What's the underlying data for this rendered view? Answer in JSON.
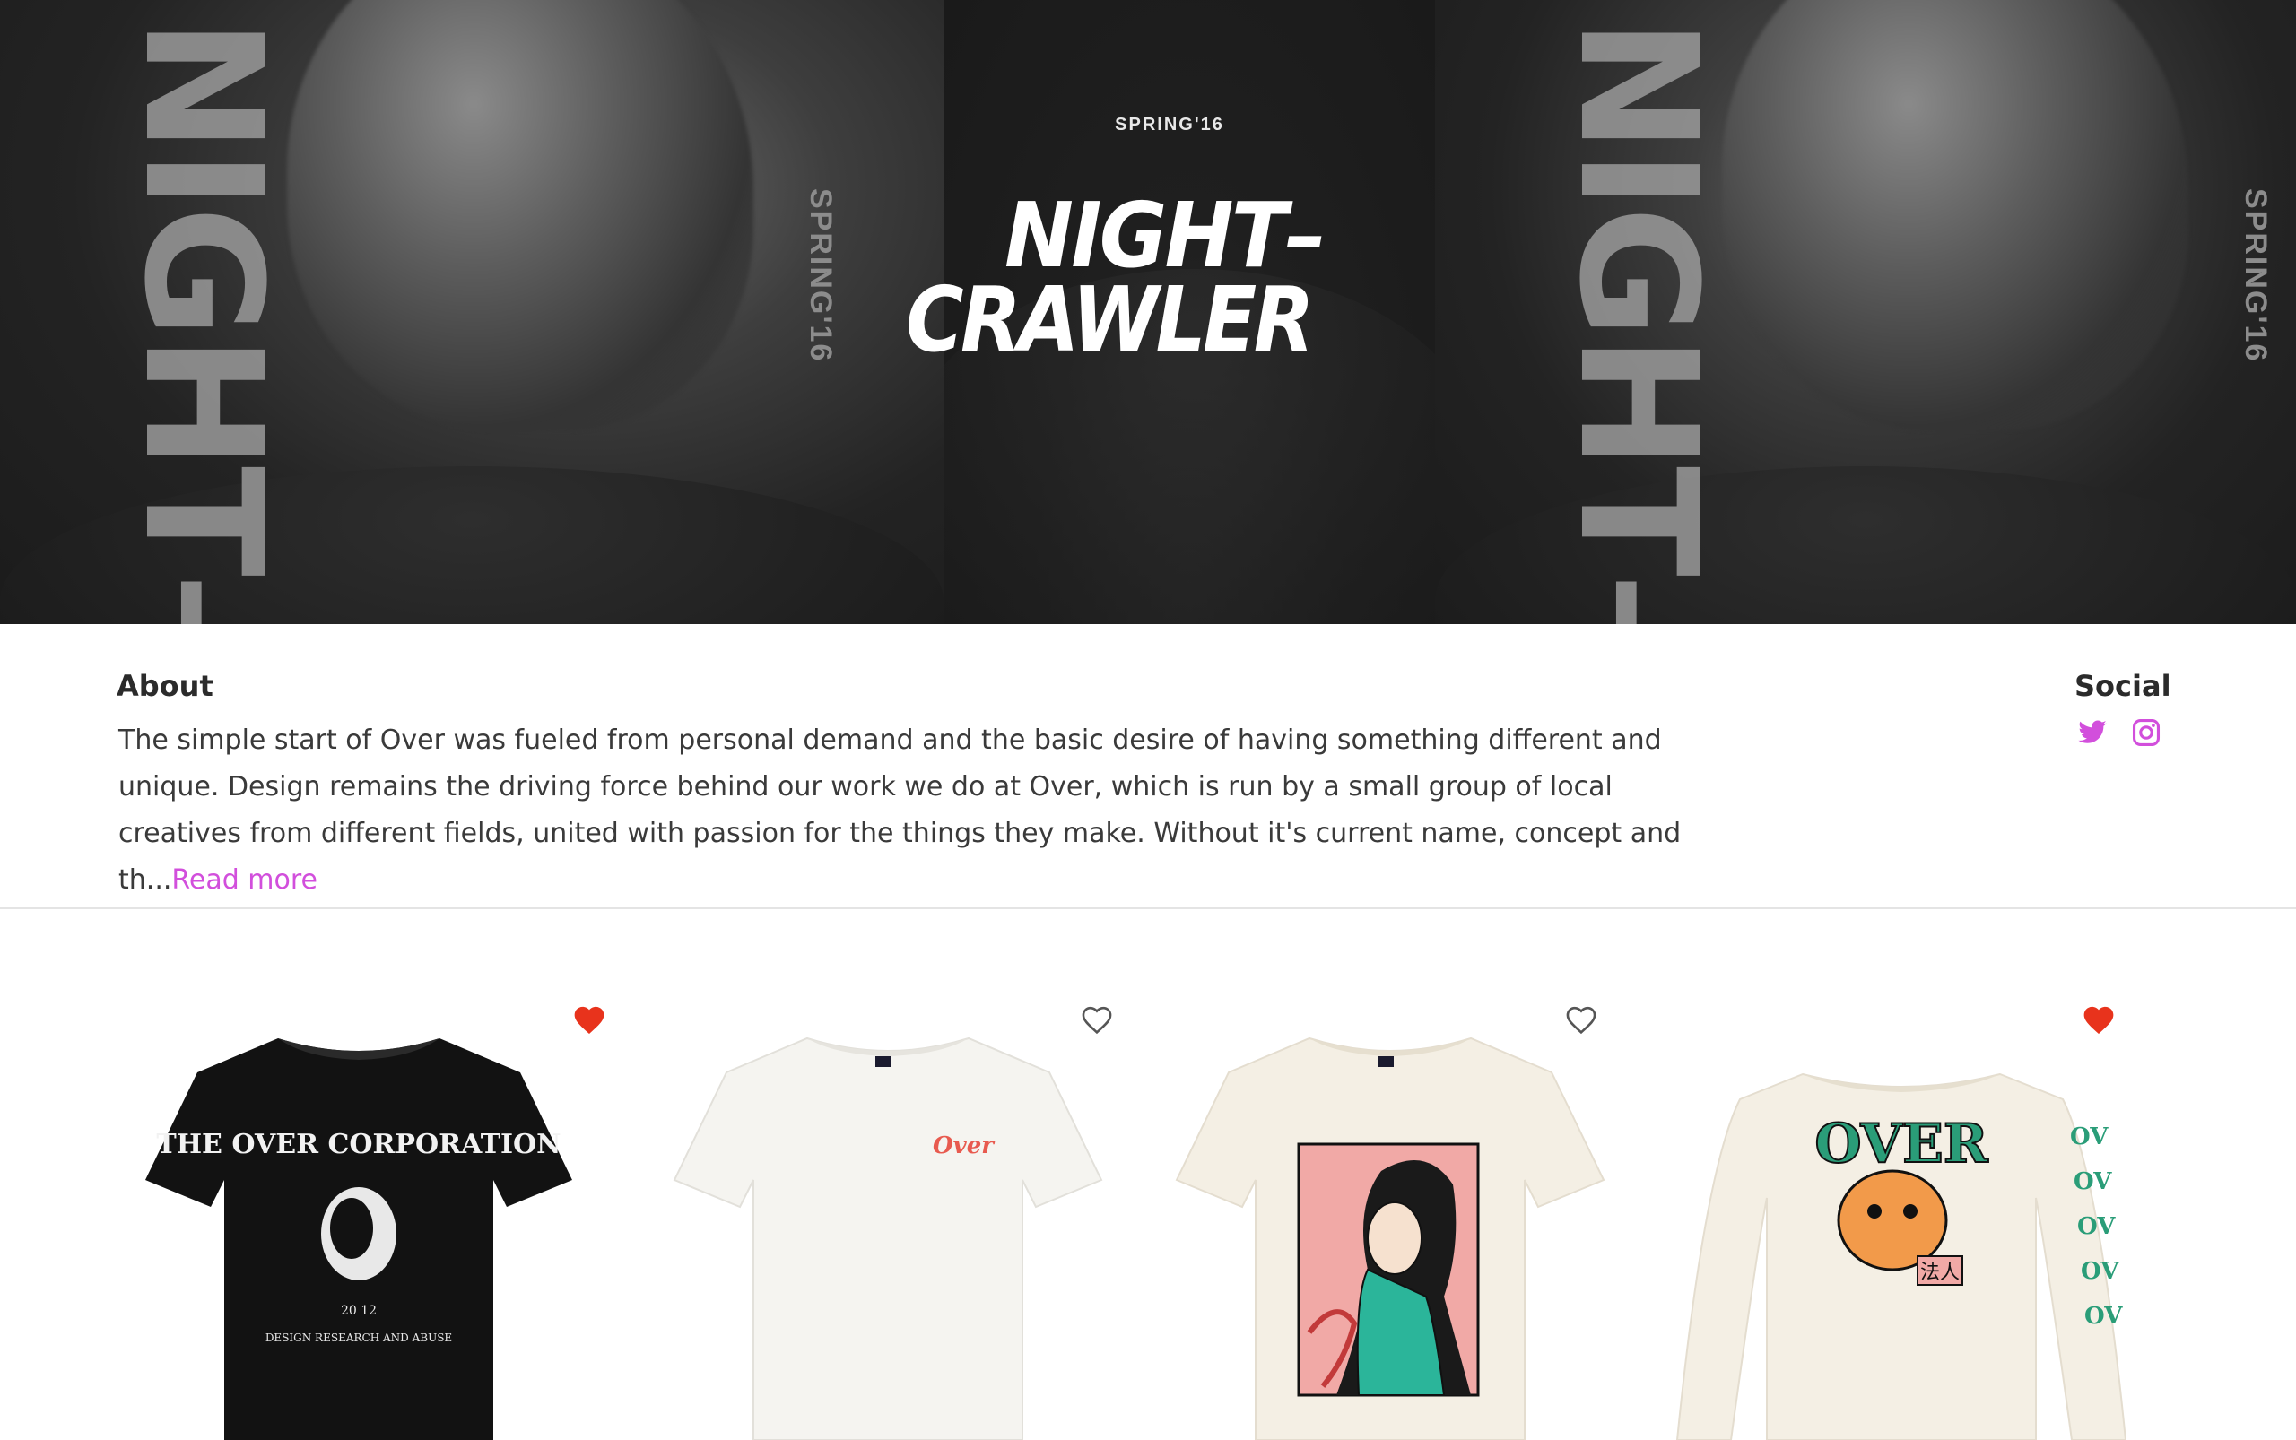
{
  "hero": {
    "season_label": "SPRING'16",
    "logo_line1": "NIGHT–",
    "logo_line2": "CRAWLER",
    "vertical_title": "NIGHT–CRAWLER",
    "vertical_season": "SPRING'16"
  },
  "about": {
    "title": "About",
    "text": "The simple start of Over was fueled from personal demand and the basic desire of having something different and unique. Design remains the driving force behind our work we do at Over, which is run by a small group of local creatives from different fields, united with passion for the things they make. Without it's current name, concept and th...",
    "read_more": "Read more"
  },
  "social": {
    "title": "Social",
    "icons": [
      "twitter-icon",
      "instagram-icon"
    ],
    "accent_color": "#d24fdc"
  },
  "products": [
    {
      "name": "black-tee-over-corporation",
      "liked": true,
      "print_text": "THE OVER CORPORATION",
      "print_year": "20 12",
      "print_sub": "DESIGN RESEARCH AND ABUSE"
    },
    {
      "name": "white-tee-over-script",
      "liked": false,
      "print_text": "Over"
    },
    {
      "name": "cream-tee-illustration",
      "liked": false
    },
    {
      "name": "cream-longsleeve-tiger",
      "liked": true,
      "print_text": "OVER",
      "print_kanji": "法人"
    }
  ],
  "colors": {
    "heart_filled": "#e8331c",
    "heart_outline": "#555555",
    "link": "#d24fdc"
  }
}
